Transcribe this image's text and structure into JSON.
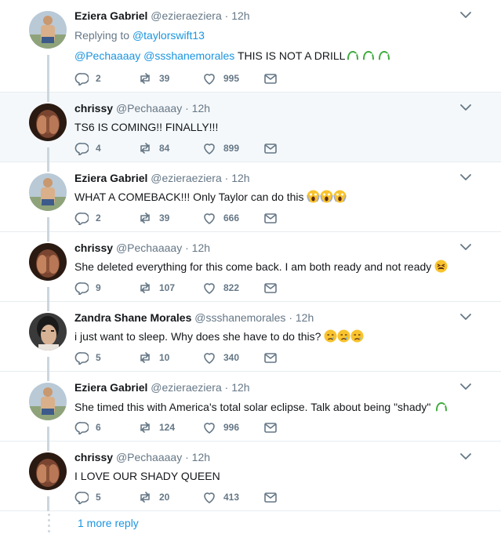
{
  "tweets": [
    {
      "name": "Eziera Gabriel",
      "handle": "@ezieraeziera",
      "dot": "·",
      "time": "12h",
      "replying_label": "Replying to",
      "replying_to": "@taylorswift13",
      "mentions": "@Pechaaaay @ssshanemorales",
      "text": " THIS IS NOT A DRILL",
      "emoji": "snake-emoji-x3",
      "replies": "2",
      "retweets": "39",
      "likes": "995",
      "avatar": "man-standing"
    },
    {
      "name": "chrissy",
      "handle": "@Pechaaaay",
      "dot": "·",
      "time": "12h",
      "text": "TS6 IS COMING!! FINALLY!!!",
      "replies": "4",
      "retweets": "84",
      "likes": "899",
      "avatar": "woman-hands-face"
    },
    {
      "name": "Eziera Gabriel",
      "handle": "@ezieraeziera",
      "dot": "·",
      "time": "12h",
      "text": "WHAT A COMEBACK!!! Only Taylor can do this ",
      "emoji": "scream-emoji-x3",
      "replies": "2",
      "retweets": "39",
      "likes": "666",
      "avatar": "man-standing"
    },
    {
      "name": "chrissy",
      "handle": "@Pechaaaay",
      "dot": "·",
      "time": "12h",
      "text": "She deleted everything for this come back. I am both ready and not ready ",
      "emoji": "tired-face-emoji",
      "replies": "9",
      "retweets": "107",
      "likes": "822",
      "avatar": "woman-hands-face"
    },
    {
      "name": "Zandra Shane Morales",
      "handle": "@ssshanemorales",
      "dot": "·",
      "time": "12h",
      "text": "i just want to sleep. Why does she have to do this? ",
      "emoji": "crying-emoji-x3",
      "replies": "5",
      "retweets": "10",
      "likes": "340",
      "avatar": "girl-portrait"
    },
    {
      "name": "Eziera Gabriel",
      "handle": "@ezieraeziera",
      "dot": "·",
      "time": "12h",
      "text": "She timed this with America's total solar eclipse. Talk about being \"shady\" ",
      "emoji": "snake-emoji",
      "replies": "6",
      "retweets": "124",
      "likes": "996",
      "avatar": "man-standing"
    },
    {
      "name": "chrissy",
      "handle": "@Pechaaaay",
      "dot": "·",
      "time": "12h",
      "text": "I LOVE OUR SHADY QUEEN",
      "replies": "5",
      "retweets": "20",
      "likes": "413",
      "avatar": "woman-hands-face"
    }
  ],
  "more_reply_label": "1 more reply",
  "colors": {
    "accent": "#1b95e0",
    "muted": "#657786",
    "rail": "#ccd6dd",
    "highlight_bg": "#f5f8fa",
    "snake": "#3dab3d",
    "emoji_yellow": "#f8c32c"
  },
  "icons": [
    "reply-icon",
    "retweet-icon",
    "like-icon",
    "dm-icon",
    "caret-down-icon"
  ]
}
